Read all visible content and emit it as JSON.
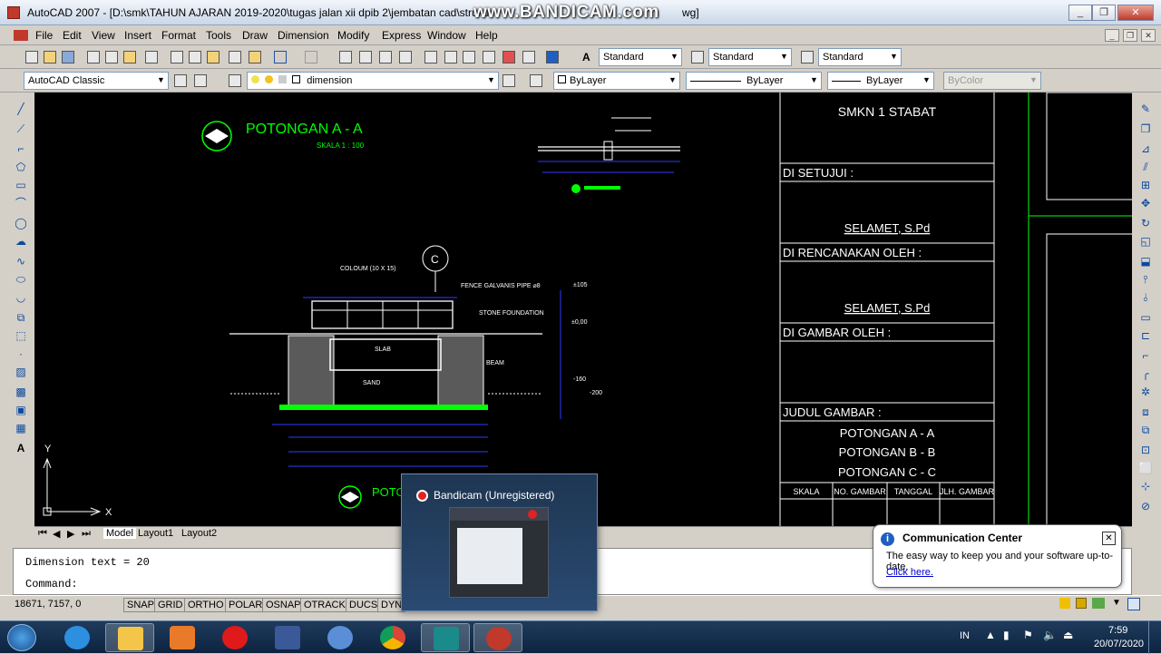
{
  "window": {
    "title": "AutoCAD 2007 - [D:\\smk\\TAHUN AJARAN 2019-2020\\tugas jalan xii dpib 2\\jembatan cad\\strukur",
    "title_suffix": "wg]",
    "watermark": "www.BANDICAM.com",
    "controls": {
      "minimize": "_",
      "restore": "❐",
      "close": "✕"
    }
  },
  "menubar": {
    "items": [
      "File",
      "Edit",
      "View",
      "Insert",
      "Format",
      "Tools",
      "Draw",
      "Dimension",
      "Modify",
      "Express",
      "Window",
      "Help"
    ],
    "mdi_controls": {
      "minimize": "_",
      "restore": "❐",
      "close": "✕"
    }
  },
  "toolbar_standard": {
    "text_style": "Standard",
    "dim_style": "Standard",
    "table_style": "Standard"
  },
  "toolbar_layers": {
    "workspace": "AutoCAD Classic",
    "layer": "dimension",
    "color": "ByLayer",
    "linetype": "ByLayer",
    "lineweight": "ByLayer",
    "plotstyle": "ByColor"
  },
  "drawing": {
    "main_title": "POTONGAN A - A",
    "scale": "SKALA 1 : 100",
    "second_title": "POTO",
    "callout": "C",
    "labels": {
      "column": "COLOUM (10 X 15)",
      "fence": "FENCE GALVANIS PIPE ⌀8",
      "stone": "STONE FOUNDATION",
      "slab": "SLAB",
      "beam": "BEAM",
      "sand": "SAND"
    },
    "levels": [
      "±105",
      "±0,00",
      "-160",
      "-200"
    ],
    "title_block": {
      "school": "SMKN 1 STABAT",
      "approved_label": "DI SETUJUI :",
      "approved_name": "SELAMET, S.Pd",
      "planned_label": "DI RENCANAKAN OLEH :",
      "planned_name": "SELAMET, S.Pd",
      "drawn_label": "DI GAMBAR OLEH :",
      "drawing_title_label": "JUDUL GAMBAR :",
      "titles": [
        "POTONGAN A - A",
        "POTONGAN B - B",
        "POTONGAN C - C"
      ],
      "columns": [
        "SKALA",
        "NO. GAMBAR",
        "TANGGAL",
        "JLH. GAMBAR"
      ]
    },
    "ucs": {
      "x": "X",
      "y": "Y"
    }
  },
  "tabs": {
    "model": "Model",
    "layout1": "Layout1",
    "layout2": "Layout2"
  },
  "command": {
    "history": "Dimension text = 20",
    "prompt": "Command:"
  },
  "status": {
    "coords": "18671, 7157, 0",
    "buttons": [
      "SNAP",
      "GRID",
      "ORTHO",
      "POLAR",
      "OSNAP",
      "OTRACK",
      "DUCS",
      "DYN"
    ]
  },
  "bandicam_popup": {
    "title": "Bandicam (Unregistered)"
  },
  "balloon": {
    "title": "Communication Center",
    "body": "The easy way to keep you and your software up-to-date.",
    "link": "Click here."
  },
  "taskbar": {
    "language": "IN",
    "time": "7:59",
    "date": "20/07/2020"
  },
  "colors": {
    "canvas": "#000000",
    "green_text": "#00ff00",
    "cad_white": "#ffffff",
    "dimension_blue": "#2b3cff",
    "taskbar": "#0d2340"
  }
}
